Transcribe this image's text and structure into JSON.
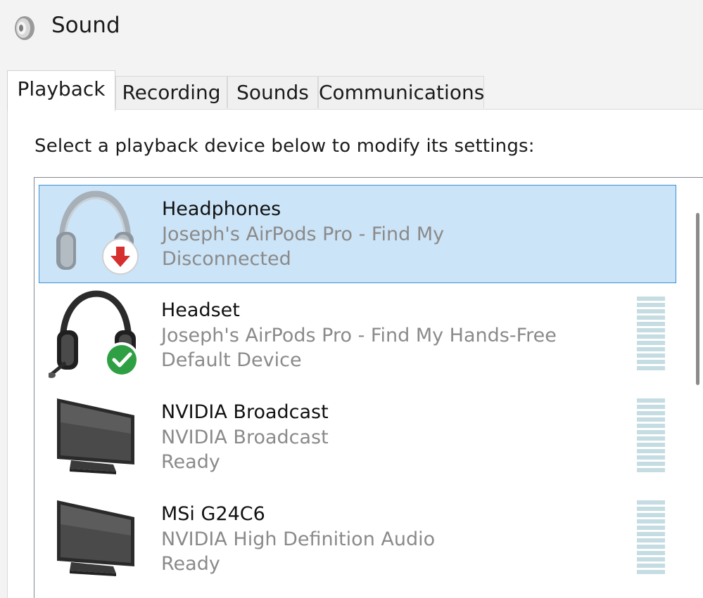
{
  "window": {
    "title": "Sound",
    "icon": "speaker-icon"
  },
  "tabs": [
    {
      "label": "Playback",
      "active": true
    },
    {
      "label": "Recording",
      "active": false
    },
    {
      "label": "Sounds",
      "active": false
    },
    {
      "label": "Communications",
      "active": false
    }
  ],
  "instruction": "Select a playback device below to modify its settings:",
  "devices": [
    {
      "name": "Headphones",
      "description": "Joseph's AirPods Pro - Find My",
      "status": "Disconnected",
      "icon": "headphones-icon",
      "badge": "disconnected-arrow-icon",
      "selected": true
    },
    {
      "name": "Headset",
      "description": "Joseph's AirPods Pro - Find My Hands-Free",
      "status": "Default Device",
      "icon": "headset-icon",
      "badge": "default-checkmark-icon",
      "selected": false
    },
    {
      "name": "NVIDIA Broadcast",
      "description": "NVIDIA Broadcast",
      "status": "Ready",
      "icon": "monitor-icon",
      "selected": false
    },
    {
      "name": "MSi G24C6",
      "description": "NVIDIA High Definition Audio",
      "status": "Ready",
      "icon": "monitor-icon",
      "selected": false
    }
  ],
  "colors": {
    "selection_bg": "#cce4f7",
    "selection_border": "#3d90d3",
    "secondary_text": "#8a8a8a",
    "disconnected_badge": "#d62f2f",
    "default_badge": "#2ea043"
  }
}
